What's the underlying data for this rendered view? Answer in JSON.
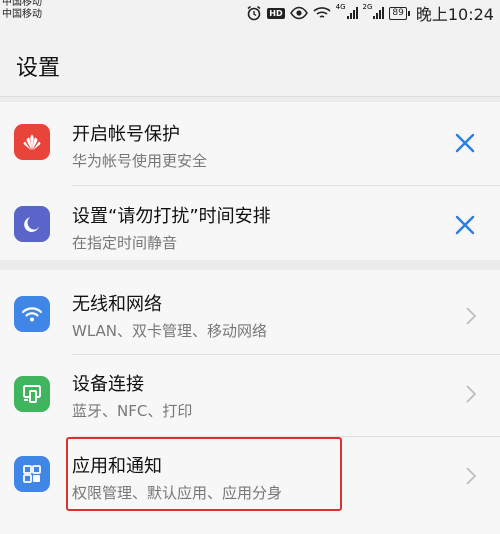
{
  "status_bar": {
    "carrier1": "中国移动",
    "carrier2": "中国移动",
    "hd": "HD",
    "net1": "4G",
    "net2": "2G",
    "battery": "89",
    "time": "晚上10:24"
  },
  "page": {
    "title": "设置"
  },
  "suggestions": [
    {
      "title": "开启帐号保护",
      "subtitle": "华为帐号使用更安全",
      "icon": "huawei-logo-icon",
      "color": "#e8443a"
    },
    {
      "title": "设置“请勿打扰”时间安排",
      "subtitle": "在指定时间静音",
      "icon": "moon-icon",
      "color": "#5965c8"
    }
  ],
  "settings": [
    {
      "title": "无线和网络",
      "subtitle": "WLAN、双卡管理、移动网络",
      "icon": "wifi-icon",
      "color": "#3f86e6"
    },
    {
      "title": "设备连接",
      "subtitle": "蓝牙、NFC、打印",
      "icon": "device-connect-icon",
      "color": "#3fb55e"
    },
    {
      "title": "应用和通知",
      "subtitle": "权限管理、默认应用、应用分身",
      "icon": "apps-grid-icon",
      "color": "#3f86e6"
    }
  ],
  "colors": {
    "accent": "#2a7ee6",
    "highlight": "#d9322e"
  }
}
